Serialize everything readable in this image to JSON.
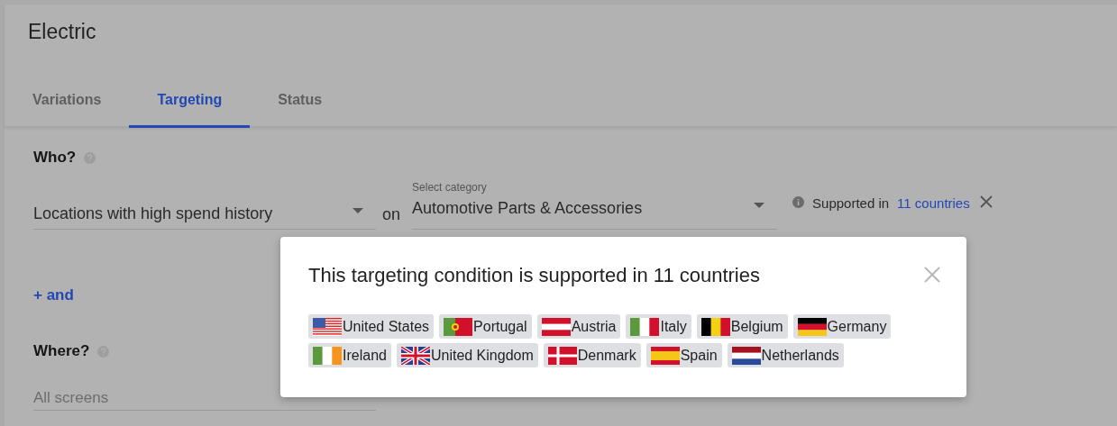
{
  "header": {
    "title": "Electric"
  },
  "tabs": [
    {
      "label": "Variations",
      "selected": false
    },
    {
      "label": "Targeting",
      "selected": true
    },
    {
      "label": "Status",
      "selected": false
    }
  ],
  "who": {
    "heading": "Who?",
    "audience": "Locations with high spend history",
    "connector": "on",
    "category_label": "Select category",
    "category": "Automotive Parts & Accessories",
    "support_text": "Supported in",
    "support_link": "11 countries"
  },
  "add_condition": "+ and",
  "where": {
    "heading": "Where?",
    "placeholder": "All screens"
  },
  "dialog": {
    "title": "This targeting condition is supported in 11 countries",
    "countries": [
      {
        "name": "United States",
        "kind": "us"
      },
      {
        "name": "Portugal",
        "kind": "pt"
      },
      {
        "name": "Austria",
        "kind": "at"
      },
      {
        "name": "Italy",
        "kind": "it"
      },
      {
        "name": "Belgium",
        "kind": "be"
      },
      {
        "name": "Germany",
        "kind": "de"
      },
      {
        "name": "Ireland",
        "kind": "ie"
      },
      {
        "name": "United Kingdom",
        "kind": "gb"
      },
      {
        "name": "Denmark",
        "kind": "dk"
      },
      {
        "name": "Spain",
        "kind": "es"
      },
      {
        "name": "Netherlands",
        "kind": "nl"
      }
    ]
  }
}
